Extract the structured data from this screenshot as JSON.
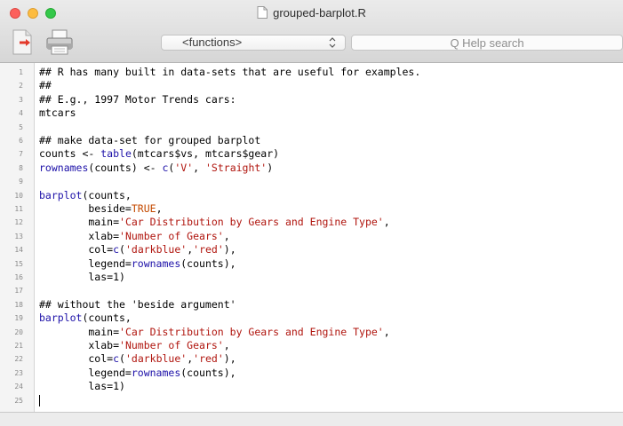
{
  "window": {
    "title": "grouped-barplot.R"
  },
  "toolbar": {
    "source_icon": "source-file-icon",
    "print_icon": "printer-icon",
    "functions_label": "<functions>",
    "help_search_placeholder": "Q Help search"
  },
  "colors": {
    "string": "#b0150e",
    "keyword": "#c44a00",
    "function": "#1c10a8",
    "gutter_bg": "#f4f4f4"
  },
  "editor": {
    "line_numbers": [
      "1",
      "2",
      "3",
      "4",
      "5",
      "6",
      "7",
      "8",
      "9",
      "10",
      "11",
      "12",
      "13",
      "14",
      "15",
      "16",
      "17",
      "18",
      "19",
      "20",
      "21",
      "22",
      "23",
      "24",
      "25"
    ],
    "lines": [
      "## R has many built in data-sets that are useful for examples.",
      "##",
      "## E.g., 1997 Motor Trends cars:",
      "mtcars",
      "",
      "## make data-set for grouped barplot",
      "counts <- table(mtcars$vs, mtcars$gear)",
      "rownames(counts) <- c('V', 'Straight')",
      "",
      "barplot(counts,",
      "        beside=TRUE,",
      "        main='Car Distribution by Gears and Engine Type',",
      "        xlab='Number of Gears',",
      "        col=c('darkblue','red'),",
      "        legend=rownames(counts),",
      "        las=1)",
      "",
      "## without the 'beside argument'",
      "barplot(counts,",
      "        main='Car Distribution by Gears and Engine Type',",
      "        xlab='Number of Gears',",
      "        col=c('darkblue','red'),",
      "        legend=rownames(counts),",
      "        las=1)",
      ""
    ]
  }
}
